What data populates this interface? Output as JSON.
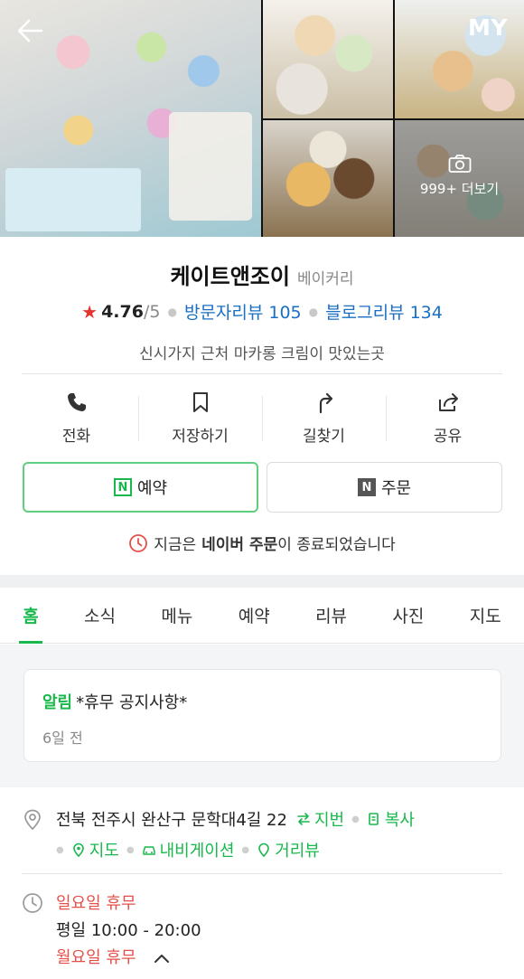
{
  "header": {
    "my_label": "MY",
    "more_photos_label": "999+ 더보기"
  },
  "place": {
    "name": "케이트앤조이",
    "category": "베이커리",
    "rating": "4.76",
    "rating_scale": "/5",
    "visitor_reviews": "방문자리뷰 105",
    "blog_reviews": "블로그리뷰 134",
    "description": "신시가지 근처 마카롱 크림이 맛있는곳"
  },
  "actions": [
    {
      "label": "전화",
      "icon": "phone-icon"
    },
    {
      "label": "저장하기",
      "icon": "bookmark-icon"
    },
    {
      "label": "길찾기",
      "icon": "directions-icon"
    },
    {
      "label": "공유",
      "icon": "share-icon"
    }
  ],
  "buttons": {
    "reserve_label": "예약",
    "order_label": "주문",
    "n_badge": "N"
  },
  "notice": {
    "prefix": "지금은",
    "highlight": "네이버 주문",
    "suffix": "이 종료되었습니다"
  },
  "tabs": [
    "홈",
    "소식",
    "메뉴",
    "예약",
    "리뷰",
    "사진",
    "지도"
  ],
  "alert": {
    "tag": "알림",
    "title": "*휴무 공지사항*",
    "time": "6일 전"
  },
  "address": {
    "text": "전북 전주시 완산구 문학대4길 22",
    "jibun_label": "지번",
    "copy_label": "복사",
    "map_label": "지도",
    "navigation_label": "내비게이션",
    "streetview_label": "거리뷰"
  },
  "hours": {
    "sunday": "일요일 휴무",
    "weekday": "평일 10:00 - 20:00",
    "monday": "월요일 휴무"
  },
  "colors": {
    "accent_green": "#19b84c",
    "link_blue": "#1a6fc3",
    "alert_red": "#e4504a",
    "star_red": "#e3342f"
  }
}
